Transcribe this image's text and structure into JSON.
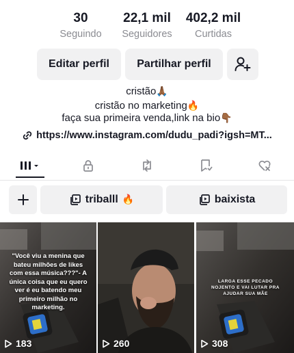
{
  "stats": [
    {
      "value": "30",
      "label": "Seguindo"
    },
    {
      "value": "22,1 mil",
      "label": "Seguidores"
    },
    {
      "value": "402,2 mil",
      "label": "Curtidas"
    }
  ],
  "actions": {
    "edit_label": "Editar perfil",
    "share_label": "Partilhar perfil",
    "add_friend_icon": "add-user-icon"
  },
  "bio": {
    "line1": "cristão",
    "line1_emoji": "🙏🏾",
    "line2": "cristão no marketing",
    "line2_emoji": "🔥",
    "line3": "faça sua primeira venda,link na bio",
    "line3_emoji": "👇🏾"
  },
  "link": {
    "icon": "link-icon",
    "url": "https://www.instagram.com/dudu_padi?igsh=MT..."
  },
  "tabs": [
    {
      "icon": "grid-icon",
      "active": true
    },
    {
      "icon": "lock-icon",
      "active": false
    },
    {
      "icon": "repost-icon",
      "active": false
    },
    {
      "icon": "bookmark-icon",
      "active": false
    },
    {
      "icon": "liked-icon",
      "active": false
    }
  ],
  "playlists": {
    "add_icon": "plus-icon",
    "items": [
      {
        "label": "triballl",
        "emoji": "🔥",
        "icon": "playlist-icon"
      },
      {
        "label": "baixista",
        "emoji": "",
        "icon": "playlist-icon"
      }
    ]
  },
  "videos": [
    {
      "views": "183",
      "caption": "\"Você viu a menina que bateu milhões de likes com essa música???\"- A única coisa que eu quero ver é eu batendo meu primeiro milhão no marketing."
    },
    {
      "views": "260",
      "caption": ""
    },
    {
      "views": "308",
      "caption": "LARGA ESSE PECADO NOJENTO E VAI LUTAR PRA AJUDAR SUA MÃE"
    }
  ],
  "colors": {
    "text": "#161823",
    "secondary": "#8a8b91",
    "button_bg": "#f1f1f2"
  }
}
